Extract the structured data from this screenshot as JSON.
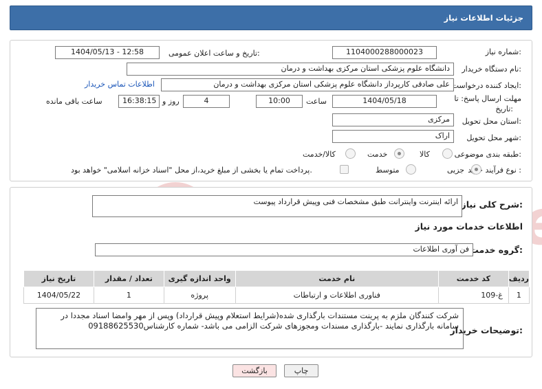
{
  "header": {
    "title": "جزئیات اطلاعات نیاز"
  },
  "form": {
    "need_number_label": "شماره نیاز:",
    "need_number": "1104000288000023",
    "announce_label": "تاریخ و ساعت اعلان عمومی:",
    "announce_value": "1404/05/13 - 12:58",
    "buyer_org_label": "نام دستگاه خریدار:",
    "buyer_org": "دانشگاه علوم پزشکی  استان مرکزی   بهداشت و درمان",
    "requester_label": "ایجاد کننده درخواست:",
    "requester": "علی صادقی کارپرداز دانشگاه علوم پزشکی  استان مرکزی   بهداشت و درمان",
    "buyer_contact_link": "اطلاعات تماس خریدار",
    "deadline_label_1": "مهلت ارسال پاسخ: تا",
    "deadline_label_2": "تاریخ:",
    "deadline_date": "1404/05/18",
    "time_label": "ساعت",
    "deadline_time": "10:00",
    "days_value": "4",
    "days_label": "روز و",
    "remaining_time": "16:38:15",
    "remaining_label": "ساعت باقی مانده",
    "province_label": "استان محل تحویل:",
    "province": "مرکزی",
    "city_label": "شهر محل تحویل:",
    "city": "اراک",
    "category_label": "طبقه بندی موضوعی:",
    "category_options": [
      "کالا",
      "خدمت",
      "کالا/خدمت"
    ],
    "category_selected": "خدمت",
    "purchase_type_label": "نوع فرآیند خرید :",
    "purchase_type_options": [
      "جزیی",
      "متوسط"
    ],
    "purchase_type_selected": "جزیی",
    "payment_note": "پرداخت تمام یا بخشی از مبلغ خرید،از محل \"اسناد خزانه اسلامی\" خواهد بود."
  },
  "summary": {
    "label": "شرح کلی نیاز:",
    "text": "ارائه اینترنت واینترانت طبق مشخصات فنی وپیش قرارداد پیوست"
  },
  "services": {
    "section_title": "اطلاعات خدمات مورد نیاز",
    "group_label": "گروه خدمت:",
    "group_value": "فن آوری اطلاعات",
    "columns": [
      "ردیف",
      "کد خدمت",
      "نام خدمت",
      "واحد اندازه گیری",
      "تعداد / مقدار",
      "تاریخ نیاز"
    ],
    "rows": [
      {
        "row": "1",
        "code": "غ-109",
        "name": "فناوری اطلاعات و ارتباطات",
        "unit": "پروژه",
        "qty": "1",
        "date": "1404/05/22"
      }
    ]
  },
  "buyer_notes": {
    "label": "توضیحات خریدار:",
    "text": "شرکت کنندگان ملزم به پرینت مستندات بارگذاری شده(شرایط  استعلام وپیش قرارداد) وپس از مهر وامضا اسناد مجددا در سامانه بارگذاری نمایند -بارگذاری مسندات ومجوزهای شرکت الزامی می باشد- شماره کارشناس09188625530"
  },
  "buttons": {
    "print": "چاپ",
    "back": "بازگشت"
  },
  "watermark": {
    "text": "AriaTender.net"
  },
  "colors": {
    "header_bg": "#3d6fa8",
    "link": "#1a55b8",
    "back_button_bg": "#fbe3e3"
  }
}
